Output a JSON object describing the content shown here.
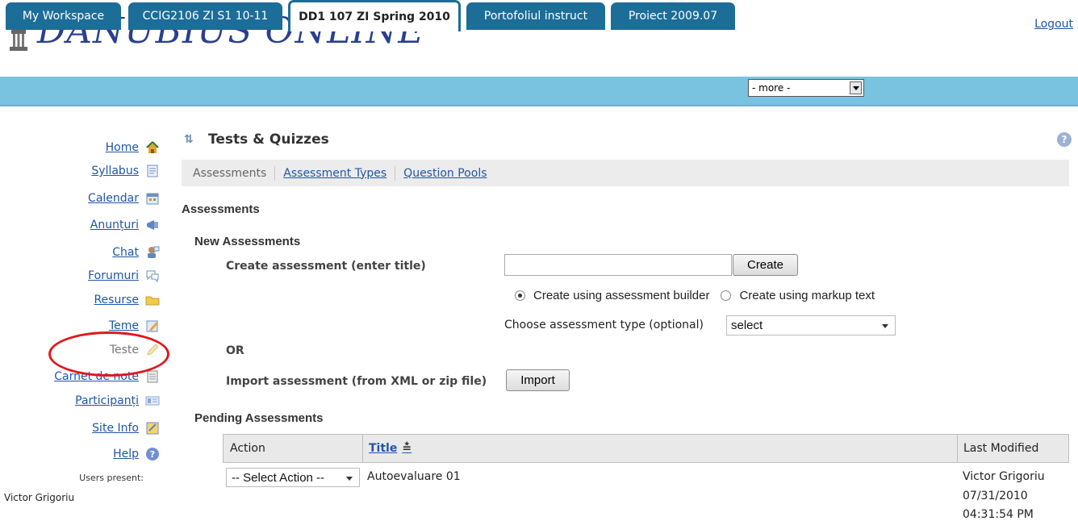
{
  "header": {
    "logo_text": "DANUBIUS ONLINE",
    "logout_label": "Logout"
  },
  "tabs": [
    {
      "label": "My Workspace",
      "active": false
    },
    {
      "label": "CCIG2106 ZI S1 10-11",
      "active": false
    },
    {
      "label": "DD1 107 ZI Spring 2010",
      "active": true
    },
    {
      "label": "Portofoliul instruct",
      "active": false
    },
    {
      "label": "Proiect 2009.07",
      "active": false
    }
  ],
  "more_select": {
    "value": "- more -"
  },
  "sidebar": {
    "items": [
      {
        "label": "Home",
        "icon": "home-icon",
        "current": false
      },
      {
        "label": "Syllabus",
        "icon": "syllabus-icon",
        "current": false
      },
      {
        "label": "Calendar",
        "icon": "calendar-icon",
        "current": false
      },
      {
        "label": "Anunțuri",
        "icon": "announcements-icon",
        "current": false
      },
      {
        "label": "Chat",
        "icon": "chat-icon",
        "current": false
      },
      {
        "label": "Forumuri",
        "icon": "forums-icon",
        "current": false
      },
      {
        "label": "Resurse",
        "icon": "folder-icon",
        "current": false
      },
      {
        "label": "Teme",
        "icon": "assignments-icon",
        "current": false
      },
      {
        "label": "Teste",
        "icon": "pencil-icon",
        "current": true
      },
      {
        "label": "Carnet de note",
        "icon": "gradebook-icon",
        "current": false
      },
      {
        "label": "Participanți",
        "icon": "participants-icon",
        "current": false
      },
      {
        "label": "Site Info",
        "icon": "site-info-icon",
        "current": false
      },
      {
        "label": "Help",
        "icon": "help-icon",
        "current": false
      }
    ],
    "users_present_label": "Users present:",
    "users": [
      "Victor Grigoriu"
    ]
  },
  "tool": {
    "title": "Tests & Quizzes",
    "nav": {
      "current": "Assessments",
      "links": [
        "Assessment Types",
        "Question Pools"
      ]
    }
  },
  "assessments": {
    "heading": "Assessments",
    "new_heading": "New Assessments",
    "create_label": "Create assessment (enter title)",
    "title_input_value": "",
    "create_button": "Create",
    "radio_builder": "Create using assessment builder",
    "radio_markup": "Create using markup text",
    "radio_selected": "builder",
    "type_label": "Choose assessment type (optional)",
    "type_select_value": "select",
    "or_label": "OR",
    "import_label": "Import assessment (from XML or zip file)",
    "import_button": "Import",
    "pending_heading": "Pending Assessments"
  },
  "pending_table": {
    "columns": [
      "Action",
      "Title",
      "Last Modified"
    ],
    "sort_indicator": "≛",
    "rows": [
      {
        "action_value": "-- Select Action --",
        "title": "Autoevaluare 01",
        "modified_by": "Victor Grigoriu",
        "modified_date": "07/31/2010",
        "modified_time": "04:31:54 PM"
      }
    ]
  },
  "colors": {
    "tabbar_bg": "#7ac3e0",
    "tab_bg": "#1c6d98",
    "link": "#1f56a5",
    "logo": "#2a3f8f",
    "annotation": "#e0171d"
  }
}
